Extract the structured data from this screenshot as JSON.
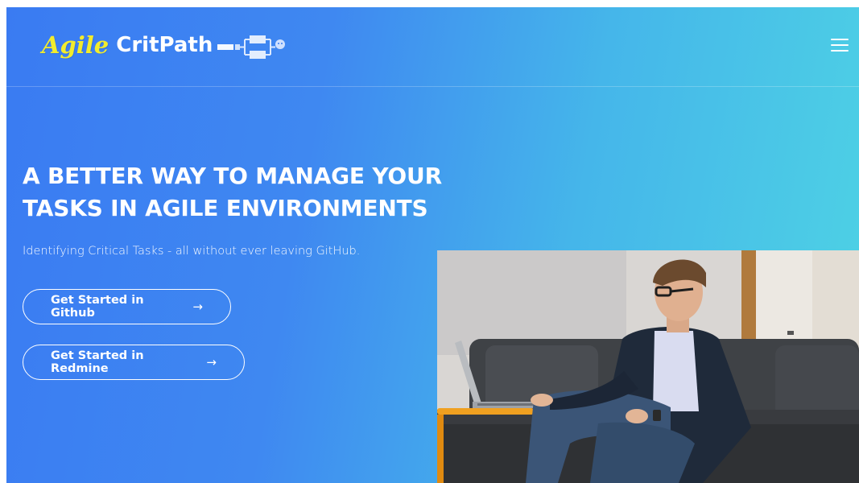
{
  "brand": {
    "agile": "Agile",
    "critpath": "CritPath",
    "accent": "#f2ec2d"
  },
  "nav": {
    "menu_icon": "hamburger-menu-icon"
  },
  "hero": {
    "title_line1": "A BETTER WAY TO MANAGE YOUR",
    "title_line2": "TASKS IN AGILE ENVIRONMENTS",
    "subtitle": "Identifying Critical Tasks - all without ever leaving GitHub.",
    "cta_github": "Get Started in Github",
    "cta_redmine": "Get Started in Redmine",
    "arrow": "→"
  },
  "colors": {
    "gradient_start": "#3a7bf2",
    "gradient_end": "#4ed3e4"
  }
}
